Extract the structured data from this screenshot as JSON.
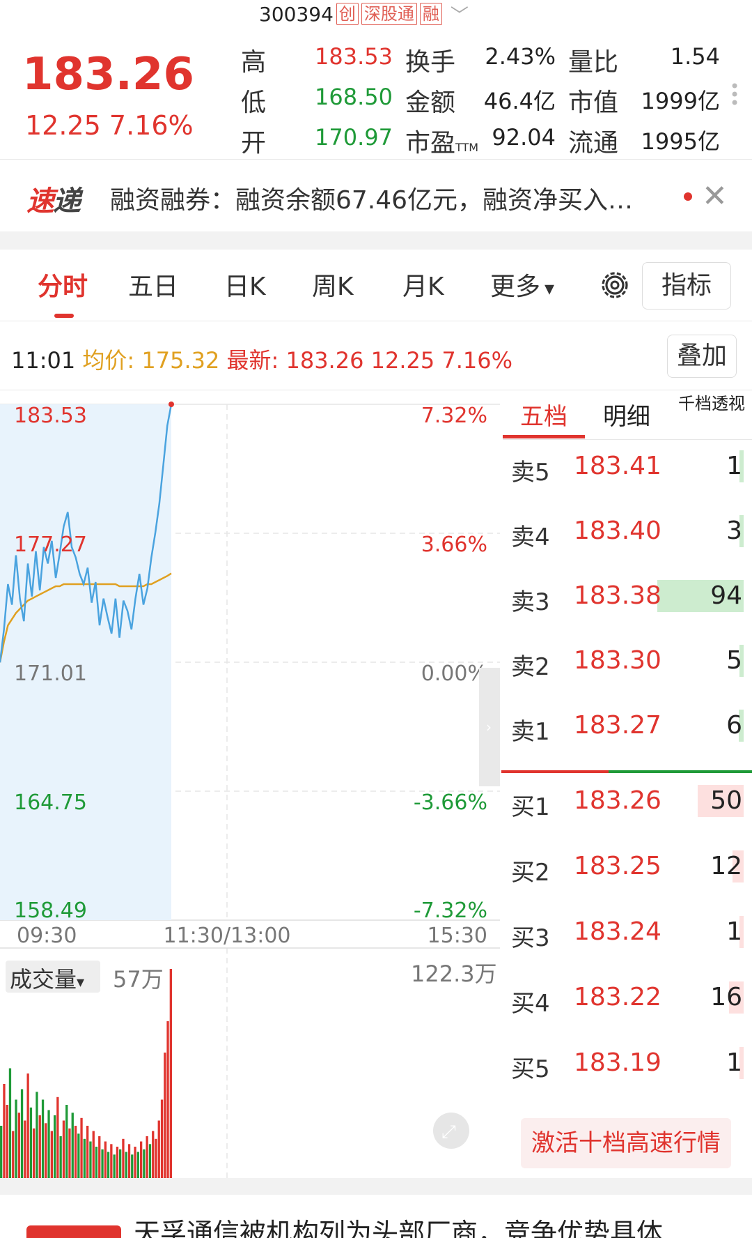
{
  "header": {
    "code": "300394",
    "tags": [
      "创",
      "深股通",
      "融"
    ],
    "price": "183.26",
    "change": "12.25",
    "change_pct": "7.16%",
    "quote": [
      {
        "label": "高",
        "value": "183.53",
        "color": "red"
      },
      {
        "label": "低",
        "value": "168.50",
        "color": "green"
      },
      {
        "label": "开",
        "value": "170.97",
        "color": "green"
      },
      {
        "label": "换手",
        "value": "2.43%"
      },
      {
        "label": "金额",
        "value": "46.4亿"
      },
      {
        "label": "市盈",
        "sub": "TTM",
        "value": "92.04"
      },
      {
        "label": "量比",
        "value": "1.54"
      },
      {
        "label": "市值",
        "value": "1999亿"
      },
      {
        "label": "流通",
        "value": "1995亿"
      }
    ]
  },
  "ticker": {
    "logo_a": "速",
    "logo_b": "递",
    "text": "融资融券：融资余额67.46亿元，融资净买入…",
    "close_icon": "close-icon"
  },
  "tabs": [
    "分时",
    "五日",
    "日K",
    "周K",
    "月K",
    "更多"
  ],
  "tabs_more_arrow": "▾",
  "indicator_button": "指标",
  "info_row": {
    "time": "11:01",
    "avg_label": "均价:",
    "avg_value": "175.32",
    "latest_label": "最新:",
    "latest_value": "183.26 12.25 7.16%"
  },
  "overlay_button": "叠加",
  "chart_data": {
    "type": "line",
    "y_labels_left": [
      "183.53",
      "177.27",
      "171.01",
      "164.75",
      "158.49"
    ],
    "y_labels_right": [
      "7.32%",
      "3.66%",
      "0.00%",
      "-3.66%",
      "-7.32%"
    ],
    "x_labels": [
      "09:30",
      "11:30/13:00",
      "15:30"
    ],
    "ylim": [
      158.49,
      183.53
    ],
    "prev_close": 171.01,
    "series": [
      {
        "values": [
          171.0,
          172.6,
          174.8,
          173.8,
          176.2,
          174.1,
          173.0,
          175.8,
          174.2,
          176.4,
          174.5,
          176.6,
          175.8,
          176.9,
          175.1,
          176.3,
          177.6,
          178.3,
          176.6,
          176.1,
          175.3,
          174.8,
          175.6,
          173.9,
          174.9,
          172.8,
          174.1,
          173.2,
          172.4,
          174.1,
          172.2,
          174.0,
          173.5,
          172.6,
          174.1,
          175.3,
          173.8,
          174.6,
          176.1,
          177.3,
          178.7,
          180.6,
          182.5,
          183.53
        ]
      },
      {
        "values": [
          171.0,
          172.0,
          172.8,
          173.1,
          173.4,
          173.6,
          173.8,
          174.0,
          174.1,
          174.2,
          174.3,
          174.4,
          174.5,
          174.6,
          174.7,
          174.7,
          174.8,
          174.8,
          174.8,
          174.8,
          174.8,
          174.8,
          174.8,
          174.8,
          174.8,
          174.8,
          174.8,
          174.8,
          174.8,
          174.8,
          174.7,
          174.7,
          174.7,
          174.7,
          174.7,
          174.7,
          174.7,
          174.8,
          174.8,
          174.9,
          175.0,
          175.1,
          175.2,
          175.32
        ]
      }
    ],
    "volume": {
      "label": "成交量",
      "label_arrow": "▾",
      "left_value": "57万",
      "right_value": "122.3万",
      "values": [
        20,
        36,
        28,
        42,
        18,
        30,
        25,
        34,
        22,
        40,
        27,
        19,
        33,
        24,
        30,
        21,
        26,
        18,
        24,
        31,
        16,
        22,
        28,
        19,
        25,
        20,
        17,
        23,
        15,
        20,
        14,
        18,
        12,
        16,
        11,
        14,
        10,
        13,
        9,
        12,
        11,
        15,
        10,
        13,
        9,
        12,
        10,
        14,
        11,
        16,
        13,
        18,
        15,
        22,
        30,
        48,
        60,
        80
      ],
      "colors": [
        "g",
        "r",
        "r",
        "g",
        "r",
        "g",
        "r",
        "g",
        "r",
        "r",
        "g",
        "r",
        "g",
        "r",
        "g",
        "r",
        "g",
        "r",
        "g",
        "r",
        "g",
        "r",
        "g",
        "r",
        "g",
        "r",
        "g",
        "r",
        "g",
        "r",
        "g",
        "r",
        "g",
        "r",
        "g",
        "r",
        "g",
        "r",
        "g",
        "r",
        "g",
        "r",
        "g",
        "r",
        "g",
        "r",
        "g",
        "r",
        "g",
        "r",
        "g",
        "r",
        "r",
        "r",
        "r",
        "r",
        "r",
        "r"
      ]
    }
  },
  "orderbook": {
    "tabs": [
      "五档",
      "明细",
      "千档透视"
    ],
    "asks": [
      {
        "label": "卖5",
        "price": "183.41",
        "vol": "1",
        "bar": 0.02
      },
      {
        "label": "卖4",
        "price": "183.40",
        "vol": "3",
        "bar": 0.03
      },
      {
        "label": "卖3",
        "price": "183.38",
        "vol": "94",
        "bar": 1.0
      },
      {
        "label": "卖2",
        "price": "183.30",
        "vol": "5",
        "bar": 0.05
      },
      {
        "label": "卖1",
        "price": "183.27",
        "vol": "6",
        "bar": 0.06
      }
    ],
    "bids": [
      {
        "label": "买1",
        "price": "183.26",
        "vol": "50",
        "bar": 0.53
      },
      {
        "label": "买2",
        "price": "183.25",
        "vol": "12",
        "bar": 0.13
      },
      {
        "label": "买3",
        "price": "183.24",
        "vol": "1",
        "bar": 0.02
      },
      {
        "label": "买4",
        "price": "183.22",
        "vol": "16",
        "bar": 0.17
      },
      {
        "label": "买5",
        "price": "183.19",
        "vol": "1",
        "bar": 0.02
      }
    ],
    "activate_button": "激活十档高速行情"
  },
  "news": {
    "text": "天孚通信被机构列为头部厂商，竞争优势具体"
  },
  "colors": {
    "up": "#e0342e",
    "down": "#1f9a38",
    "price_line": "#4aa3df",
    "avg_line": "#e0a020"
  }
}
